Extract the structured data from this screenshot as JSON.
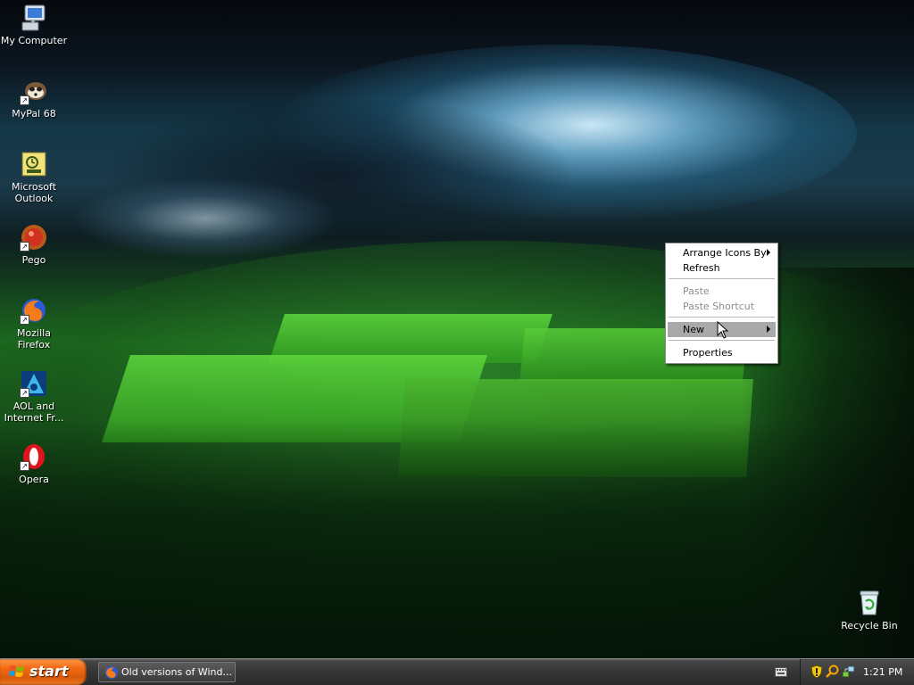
{
  "desktop": {
    "icons": [
      {
        "label": "My Computer",
        "icon": "my-computer-icon"
      },
      {
        "label": "MyPal 68",
        "icon": "mypal-icon"
      },
      {
        "label": "Microsoft Outlook",
        "icon": "outlook-icon"
      },
      {
        "label": "Pego",
        "icon": "pego-icon"
      },
      {
        "label": "Mozilla Firefox",
        "icon": "firefox-icon"
      },
      {
        "label": "AOL and Internet Fr...",
        "icon": "aol-icon"
      },
      {
        "label": "Opera",
        "icon": "opera-icon"
      },
      {
        "label": "Recycle Bin",
        "icon": "recycle-bin-icon"
      }
    ]
  },
  "context_menu": {
    "items": [
      {
        "label": "Arrange Icons By",
        "submenu": true
      },
      {
        "label": "Refresh"
      },
      {
        "label": "Paste",
        "disabled": true
      },
      {
        "label": "Paste Shortcut",
        "disabled": true
      },
      {
        "label": "New",
        "submenu": true,
        "highlighted": true
      },
      {
        "label": "Properties"
      }
    ]
  },
  "taskbar": {
    "start_label": "start",
    "task_label": "Old versions of Wind...",
    "clock": "1:21 PM"
  },
  "colors": {
    "start": "#f26a14",
    "menu_highlight": "#a9a9a9",
    "taskbar": "#353535"
  }
}
